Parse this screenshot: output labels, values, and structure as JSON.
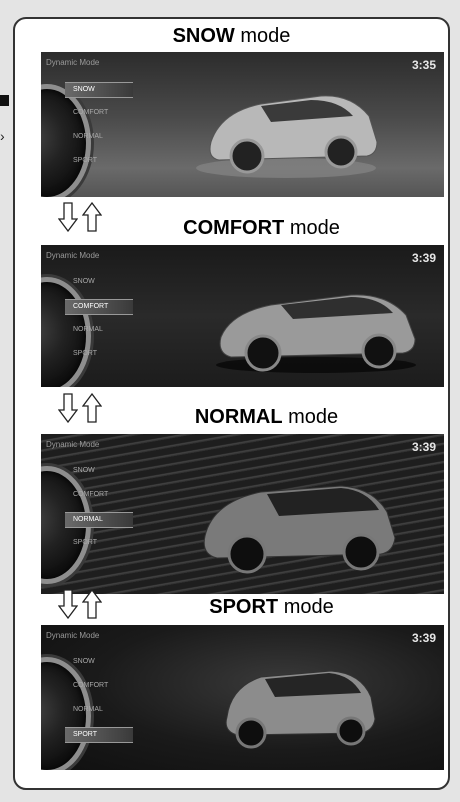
{
  "modes": [
    {
      "name": "SNOW",
      "suffix": "mode",
      "time": "3:35",
      "options": [
        "SNOW",
        "COMFORT",
        "NORMAL",
        "SPORT"
      ],
      "selected": 0
    },
    {
      "name": "COMFORT",
      "suffix": "mode",
      "time": "3:39",
      "options": [
        "SNOW",
        "COMFORT",
        "NORMAL",
        "SPORT"
      ],
      "selected": 1
    },
    {
      "name": "NORMAL",
      "suffix": "mode",
      "time": "3:39",
      "options": [
        "SNOW",
        "COMFORT",
        "NORMAL",
        "SPORT"
      ],
      "selected": 2
    },
    {
      "name": "SPORT",
      "suffix": "mode",
      "time": "3:39",
      "options": [
        "SNOW",
        "COMFORT",
        "NORMAL",
        "SPORT"
      ],
      "selected": 3
    }
  ],
  "dynamic_mode_label": "Dynamic Mode",
  "icons": {
    "down": "down-arrow-icon",
    "up": "up-arrow-icon",
    "corner": "chevron-right-icon"
  }
}
